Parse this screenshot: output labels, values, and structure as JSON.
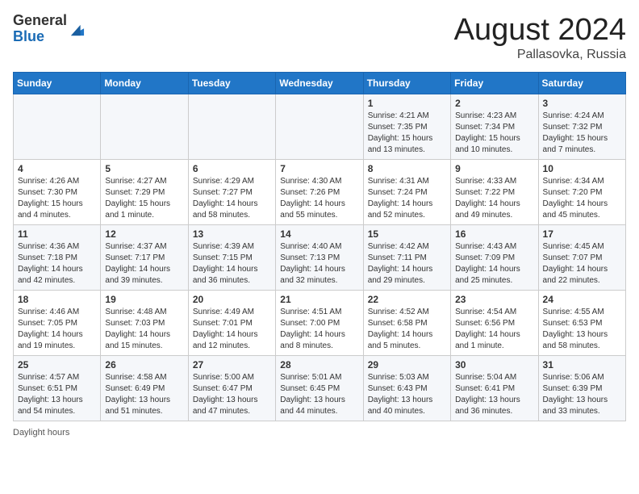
{
  "header": {
    "logo_general": "General",
    "logo_blue": "Blue",
    "month_title": "August 2024",
    "location": "Pallasovka, Russia"
  },
  "days_of_week": [
    "Sunday",
    "Monday",
    "Tuesday",
    "Wednesday",
    "Thursday",
    "Friday",
    "Saturday"
  ],
  "weeks": [
    [
      {
        "day": "",
        "info": ""
      },
      {
        "day": "",
        "info": ""
      },
      {
        "day": "",
        "info": ""
      },
      {
        "day": "",
        "info": ""
      },
      {
        "day": "1",
        "info": "Sunrise: 4:21 AM\nSunset: 7:35 PM\nDaylight: 15 hours\nand 13 minutes."
      },
      {
        "day": "2",
        "info": "Sunrise: 4:23 AM\nSunset: 7:34 PM\nDaylight: 15 hours\nand 10 minutes."
      },
      {
        "day": "3",
        "info": "Sunrise: 4:24 AM\nSunset: 7:32 PM\nDaylight: 15 hours\nand 7 minutes."
      }
    ],
    [
      {
        "day": "4",
        "info": "Sunrise: 4:26 AM\nSunset: 7:30 PM\nDaylight: 15 hours\nand 4 minutes."
      },
      {
        "day": "5",
        "info": "Sunrise: 4:27 AM\nSunset: 7:29 PM\nDaylight: 15 hours\nand 1 minute."
      },
      {
        "day": "6",
        "info": "Sunrise: 4:29 AM\nSunset: 7:27 PM\nDaylight: 14 hours\nand 58 minutes."
      },
      {
        "day": "7",
        "info": "Sunrise: 4:30 AM\nSunset: 7:26 PM\nDaylight: 14 hours\nand 55 minutes."
      },
      {
        "day": "8",
        "info": "Sunrise: 4:31 AM\nSunset: 7:24 PM\nDaylight: 14 hours\nand 52 minutes."
      },
      {
        "day": "9",
        "info": "Sunrise: 4:33 AM\nSunset: 7:22 PM\nDaylight: 14 hours\nand 49 minutes."
      },
      {
        "day": "10",
        "info": "Sunrise: 4:34 AM\nSunset: 7:20 PM\nDaylight: 14 hours\nand 45 minutes."
      }
    ],
    [
      {
        "day": "11",
        "info": "Sunrise: 4:36 AM\nSunset: 7:18 PM\nDaylight: 14 hours\nand 42 minutes."
      },
      {
        "day": "12",
        "info": "Sunrise: 4:37 AM\nSunset: 7:17 PM\nDaylight: 14 hours\nand 39 minutes."
      },
      {
        "day": "13",
        "info": "Sunrise: 4:39 AM\nSunset: 7:15 PM\nDaylight: 14 hours\nand 36 minutes."
      },
      {
        "day": "14",
        "info": "Sunrise: 4:40 AM\nSunset: 7:13 PM\nDaylight: 14 hours\nand 32 minutes."
      },
      {
        "day": "15",
        "info": "Sunrise: 4:42 AM\nSunset: 7:11 PM\nDaylight: 14 hours\nand 29 minutes."
      },
      {
        "day": "16",
        "info": "Sunrise: 4:43 AM\nSunset: 7:09 PM\nDaylight: 14 hours\nand 25 minutes."
      },
      {
        "day": "17",
        "info": "Sunrise: 4:45 AM\nSunset: 7:07 PM\nDaylight: 14 hours\nand 22 minutes."
      }
    ],
    [
      {
        "day": "18",
        "info": "Sunrise: 4:46 AM\nSunset: 7:05 PM\nDaylight: 14 hours\nand 19 minutes."
      },
      {
        "day": "19",
        "info": "Sunrise: 4:48 AM\nSunset: 7:03 PM\nDaylight: 14 hours\nand 15 minutes."
      },
      {
        "day": "20",
        "info": "Sunrise: 4:49 AM\nSunset: 7:01 PM\nDaylight: 14 hours\nand 12 minutes."
      },
      {
        "day": "21",
        "info": "Sunrise: 4:51 AM\nSunset: 7:00 PM\nDaylight: 14 hours\nand 8 minutes."
      },
      {
        "day": "22",
        "info": "Sunrise: 4:52 AM\nSunset: 6:58 PM\nDaylight: 14 hours\nand 5 minutes."
      },
      {
        "day": "23",
        "info": "Sunrise: 4:54 AM\nSunset: 6:56 PM\nDaylight: 14 hours\nand 1 minute."
      },
      {
        "day": "24",
        "info": "Sunrise: 4:55 AM\nSunset: 6:53 PM\nDaylight: 13 hours\nand 58 minutes."
      }
    ],
    [
      {
        "day": "25",
        "info": "Sunrise: 4:57 AM\nSunset: 6:51 PM\nDaylight: 13 hours\nand 54 minutes."
      },
      {
        "day": "26",
        "info": "Sunrise: 4:58 AM\nSunset: 6:49 PM\nDaylight: 13 hours\nand 51 minutes."
      },
      {
        "day": "27",
        "info": "Sunrise: 5:00 AM\nSunset: 6:47 PM\nDaylight: 13 hours\nand 47 minutes."
      },
      {
        "day": "28",
        "info": "Sunrise: 5:01 AM\nSunset: 6:45 PM\nDaylight: 13 hours\nand 44 minutes."
      },
      {
        "day": "29",
        "info": "Sunrise: 5:03 AM\nSunset: 6:43 PM\nDaylight: 13 hours\nand 40 minutes."
      },
      {
        "day": "30",
        "info": "Sunrise: 5:04 AM\nSunset: 6:41 PM\nDaylight: 13 hours\nand 36 minutes."
      },
      {
        "day": "31",
        "info": "Sunrise: 5:06 AM\nSunset: 6:39 PM\nDaylight: 13 hours\nand 33 minutes."
      }
    ]
  ],
  "legend": {
    "daylight_label": "Daylight hours"
  }
}
